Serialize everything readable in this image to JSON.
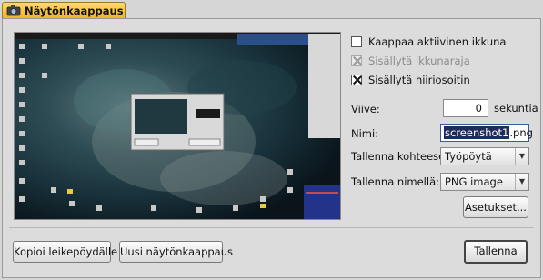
{
  "window": {
    "title": "Näytönkaappaus"
  },
  "options": {
    "capture_active_window": {
      "label": "Kaappaa aktiivinen ikkuna",
      "checked": false,
      "enabled": true
    },
    "include_border": {
      "label": "Sisällytä ikkunaraja",
      "checked": true,
      "enabled": false
    },
    "include_pointer": {
      "label": "Sisällytä hiiriosoitin",
      "checked": true,
      "enabled": true
    }
  },
  "delay": {
    "label": "Viive:",
    "value": "0",
    "unit": "sekuntia"
  },
  "name": {
    "label": "Nimi:",
    "selected_part": "screenshot1",
    "extension": ".png"
  },
  "save_to": {
    "label": "Tallenna kohteeseen:",
    "value": "Työpöytä"
  },
  "save_as": {
    "label": "Tallenna nimellä:",
    "value": "PNG image"
  },
  "buttons": {
    "settings": "Asetukset...",
    "copy_clipboard": "Kopioi leikepöydälle",
    "new_screenshot": "Uusi näytönkaappaus",
    "save": "Tallenna"
  },
  "colors": {
    "tab_accent": "#f3b520",
    "selection": "#1f2b5a"
  },
  "icons": {
    "tab_icon": "camera-icon",
    "combo_arrow": "chevron-down-icon"
  }
}
